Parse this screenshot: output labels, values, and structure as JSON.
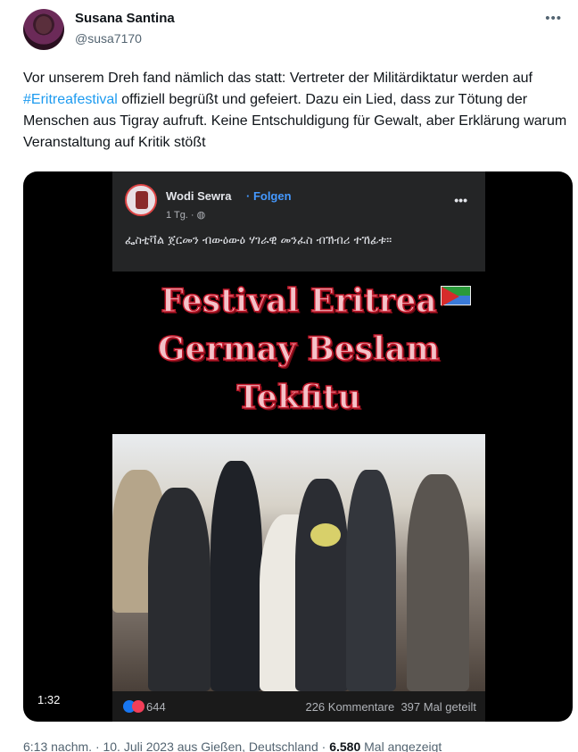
{
  "author": {
    "name": "Susana Santina",
    "handle": "@susa7170"
  },
  "tweet": {
    "text_before": "Vor unserem Dreh fand nämlich das statt: Vertreter der Militärdiktatur werden auf ",
    "hashtag": "#Eritreafestival",
    "text_after": " offiziell begrüßt und gefeiert. Dazu ein Lied, dass zur Tötung der Menschen aus Tigray aufruft. Keine Entschuldigung für Gewalt, aber Erklärung warum Veranstaltung auf Kritik stößt"
  },
  "media": {
    "duration": "1:32",
    "embedded_post": {
      "page_name": "Wodi Sewra",
      "follow": "· Folgen",
      "time": "1 Tg. · ",
      "caption": "ፌስቲቫል ጀርመን ብውዕውዕ ሃገራዊ መንፈስ ብኽብሪ ተኸፊቱ።",
      "banner": [
        "Festival Eritrea",
        "Germay Beslam",
        "Tekfitu"
      ],
      "reaction_count": "644",
      "comments": "226 Kommentare",
      "shares": "397 Mal geteilt"
    }
  },
  "meta": {
    "time_date_place": "6:13 nachm. · 10. Juli 2023 aus Gießen, Deutschland · ",
    "views": "6.580",
    "views_label": " Mal angezeigt"
  },
  "colors": {
    "link": "#1d9bf0",
    "secondary_text": "#536471",
    "fb_blue": "#4599ff"
  }
}
